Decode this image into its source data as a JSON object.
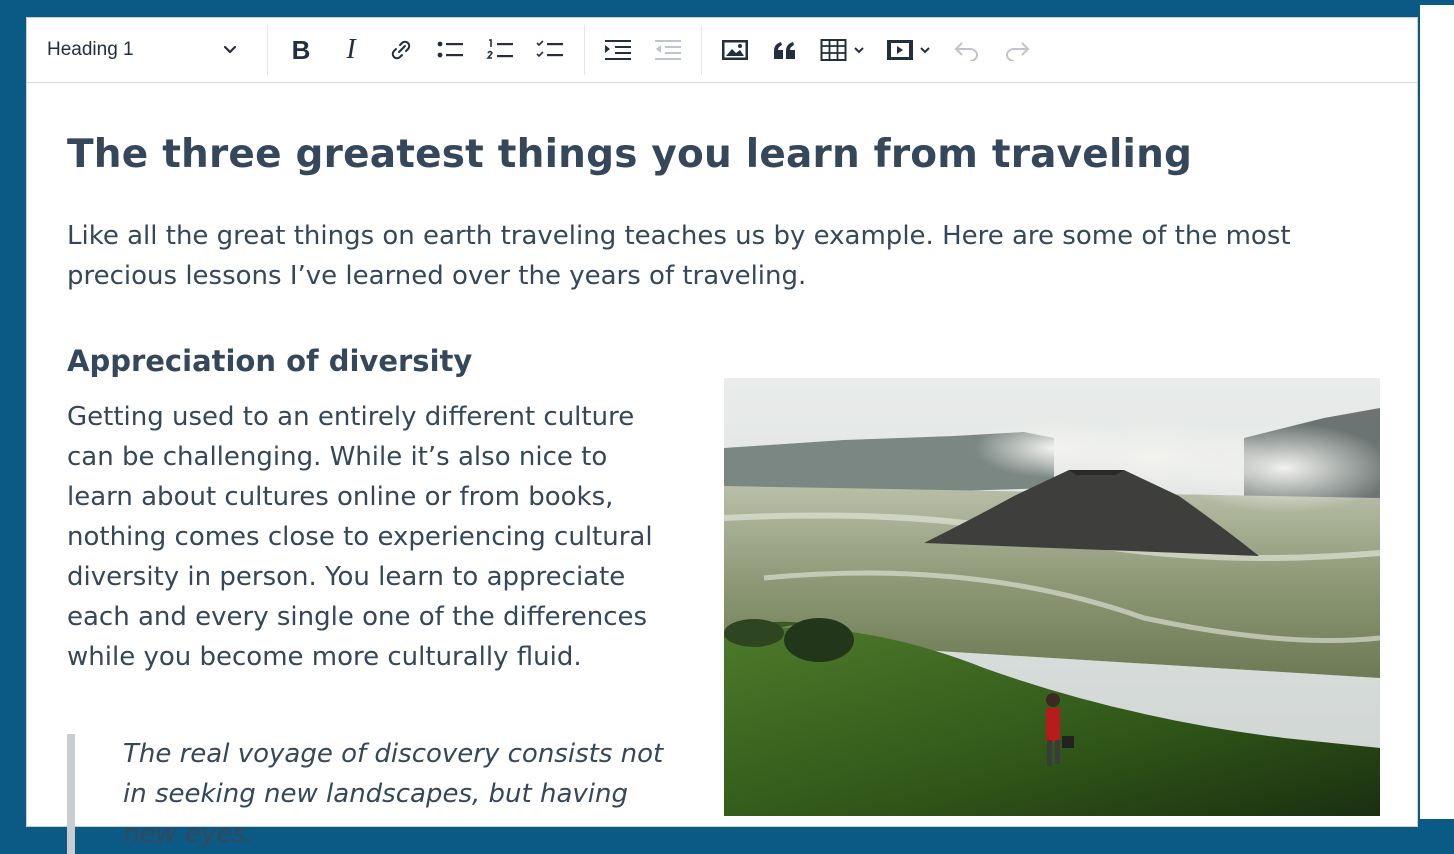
{
  "toolbar": {
    "block_format_value": "Heading 1",
    "buttons": [
      {
        "name": "bold-icon",
        "label": "B"
      },
      {
        "name": "italic-icon",
        "label": "I"
      }
    ]
  },
  "document": {
    "title": "The three greatest things you learn from traveling",
    "intro": "Like all the great things on earth traveling teaches us by example. Here are some of the most precious lessons I’ve learned over the years of traveling.",
    "section_heading": "Appreciation of diversity",
    "section_body": "Getting used to an entirely different culture can be challenging. While it’s also nice to learn about cultures online or from books, nothing comes close to experiencing cultural diversity in person. You learn to appreciate each and every single one of the differences while you become more culturally fluid.",
    "quote": "The real voyage of discovery consists not in seeking new landscapes, but having new eyes."
  },
  "colors": {
    "frame": "#0b5a86",
    "text": "#35475a",
    "toolbar_icon": "#222f3e",
    "disabled_icon": "#bfc5cc"
  }
}
